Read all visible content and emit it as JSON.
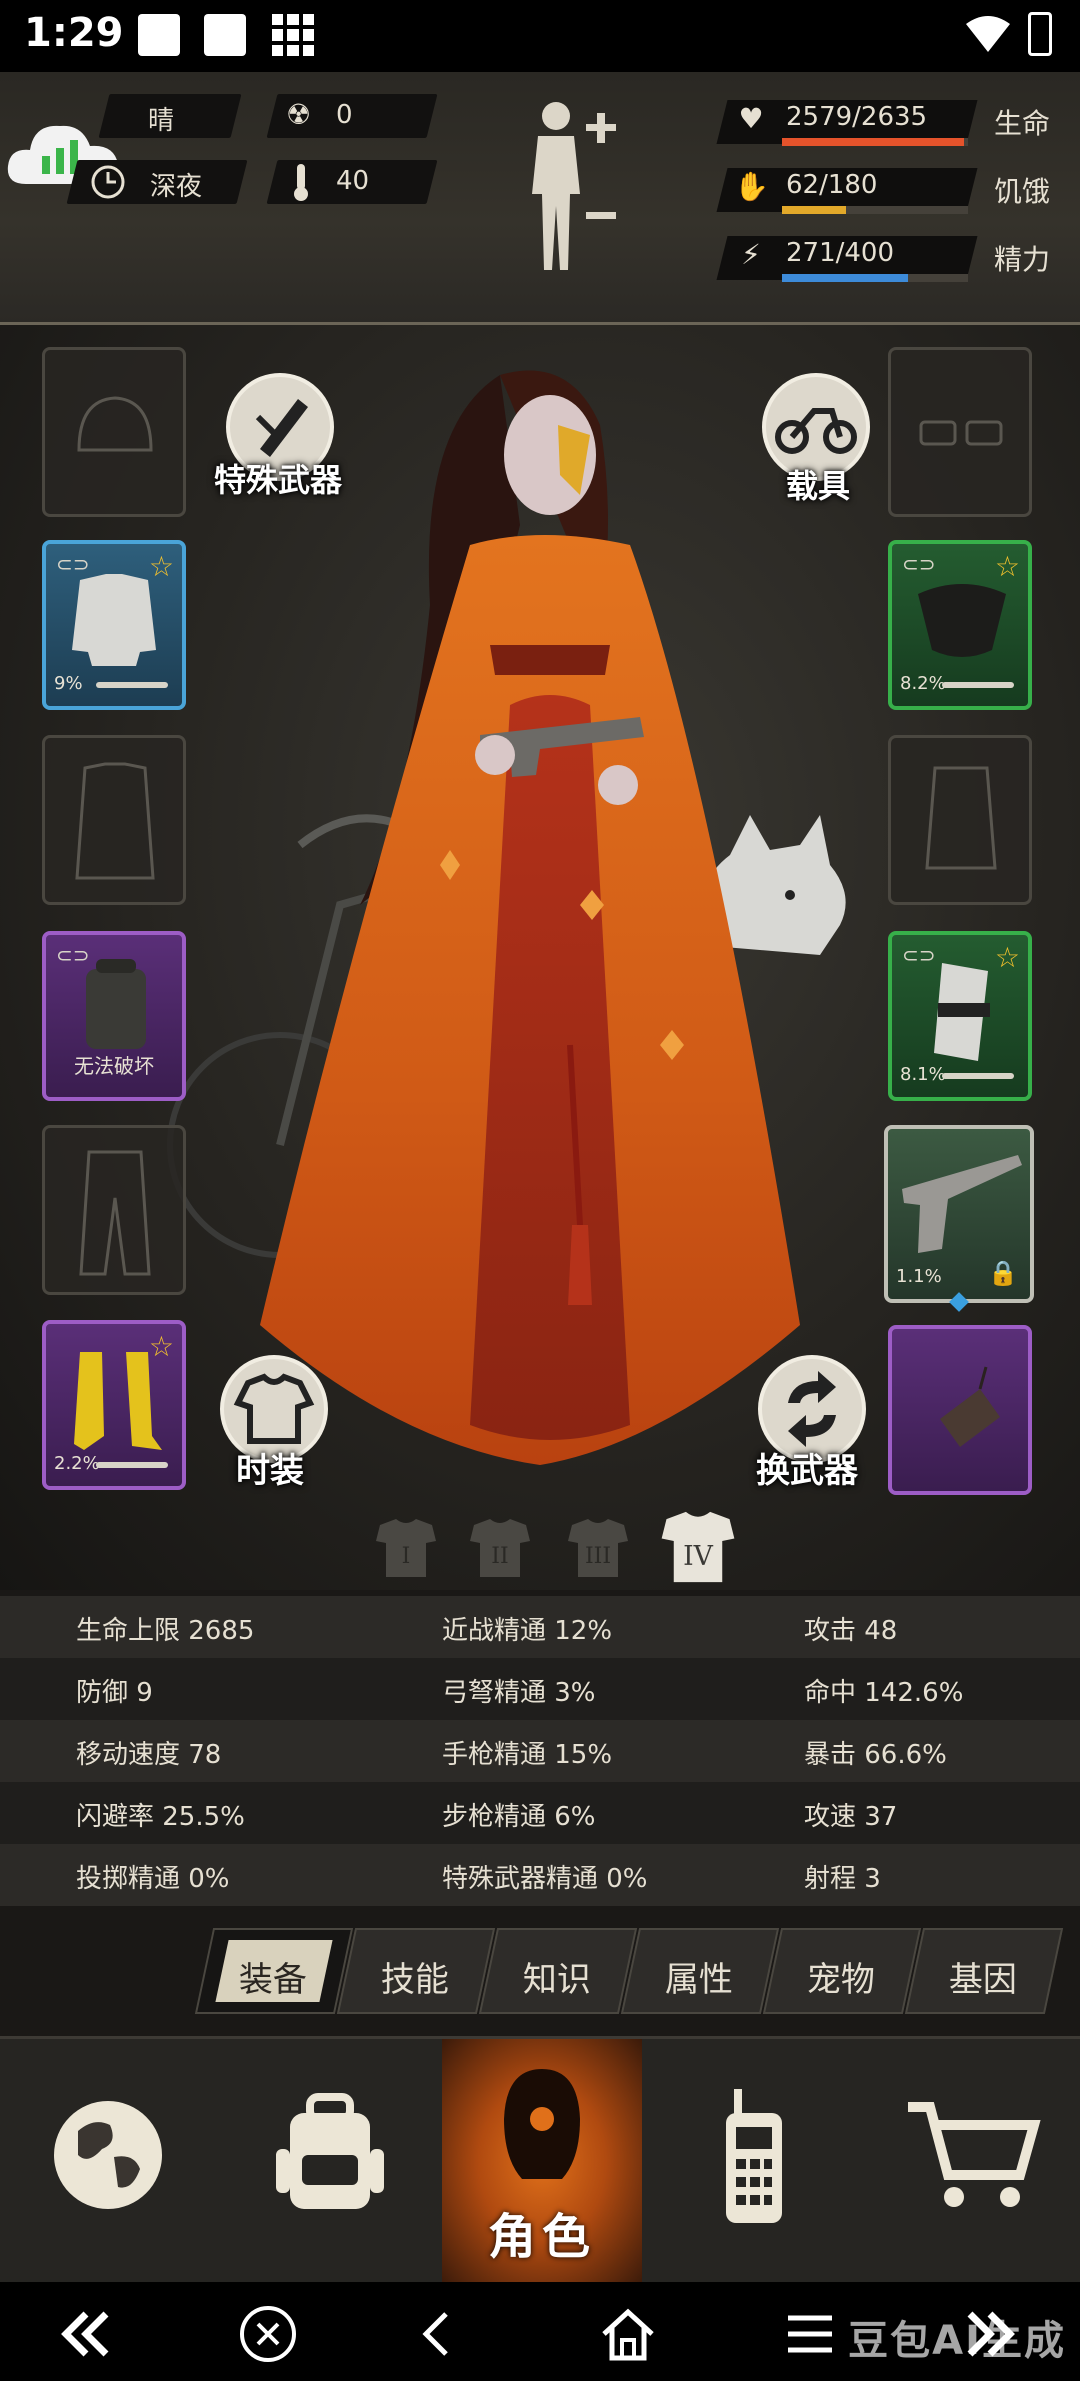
{
  "status_bar": {
    "time": "1:29"
  },
  "hud": {
    "weather": "晴",
    "radiation": "0",
    "time_of_day": "深夜",
    "temperature": "40",
    "health": {
      "text": "2579/2635",
      "label": "生命",
      "fraction": 0.979,
      "color": "#e5532b"
    },
    "hunger": {
      "text": "62/180",
      "label": "饥饿",
      "fraction": 0.344,
      "color": "#e3a92a"
    },
    "energy": {
      "text": "271/400",
      "label": "精力",
      "fraction": 0.678,
      "color": "#3d8bd9"
    }
  },
  "equipment": {
    "special_weapon_label": "特殊武器",
    "vehicle_label": "载具",
    "outfit_label": "时装",
    "swap_weapon_label": "换武器",
    "left_slots": [
      {
        "rarity": "empty",
        "item": "helmet-slot-icon"
      },
      {
        "rarity": "blue",
        "item": "shirt-icon",
        "durability": "9%"
      },
      {
        "rarity": "empty",
        "item": "coat-slot-icon"
      },
      {
        "rarity": "purple",
        "item": "backpack-icon",
        "note": "无法破坏"
      },
      {
        "rarity": "empty",
        "item": "pants-slot-icon"
      },
      {
        "rarity": "purple",
        "item": "boots-icon",
        "durability": "2.2%"
      }
    ],
    "right_slots": [
      {
        "rarity": "empty",
        "item": "glasses-slot-icon"
      },
      {
        "rarity": "green",
        "item": "mask-icon",
        "durability": "8.2%"
      },
      {
        "rarity": "empty",
        "item": "vest-slot-icon"
      },
      {
        "rarity": "green",
        "item": "armguard-icon",
        "durability": "8.1%"
      },
      {
        "rarity": "gray",
        "item": "shotgun-icon",
        "durability": "1.1%"
      },
      {
        "rarity": "purple",
        "item": "grenade-icon"
      }
    ],
    "outfit_tabs": [
      "I",
      "II",
      "III",
      "IV"
    ],
    "active_outfit": "IV"
  },
  "stats": [
    [
      "生命上限 2685",
      "近战精通 12%",
      "攻击 48"
    ],
    [
      "防御 9",
      "弓弩精通 3%",
      "命中 142.6%"
    ],
    [
      "移动速度 78",
      "手枪精通 15%",
      "暴击 66.6%"
    ],
    [
      "闪避率 25.5%",
      "步枪精通 6%",
      "攻速 37"
    ],
    [
      "投掷精通 0%",
      "特殊武器精通 0%",
      "射程 3"
    ]
  ],
  "tabs": [
    "装备",
    "技能",
    "知识",
    "属性",
    "宠物",
    "基因"
  ],
  "active_tab": "装备",
  "nav": {
    "role_label": "角色"
  },
  "watermark": "豆包AI生成"
}
